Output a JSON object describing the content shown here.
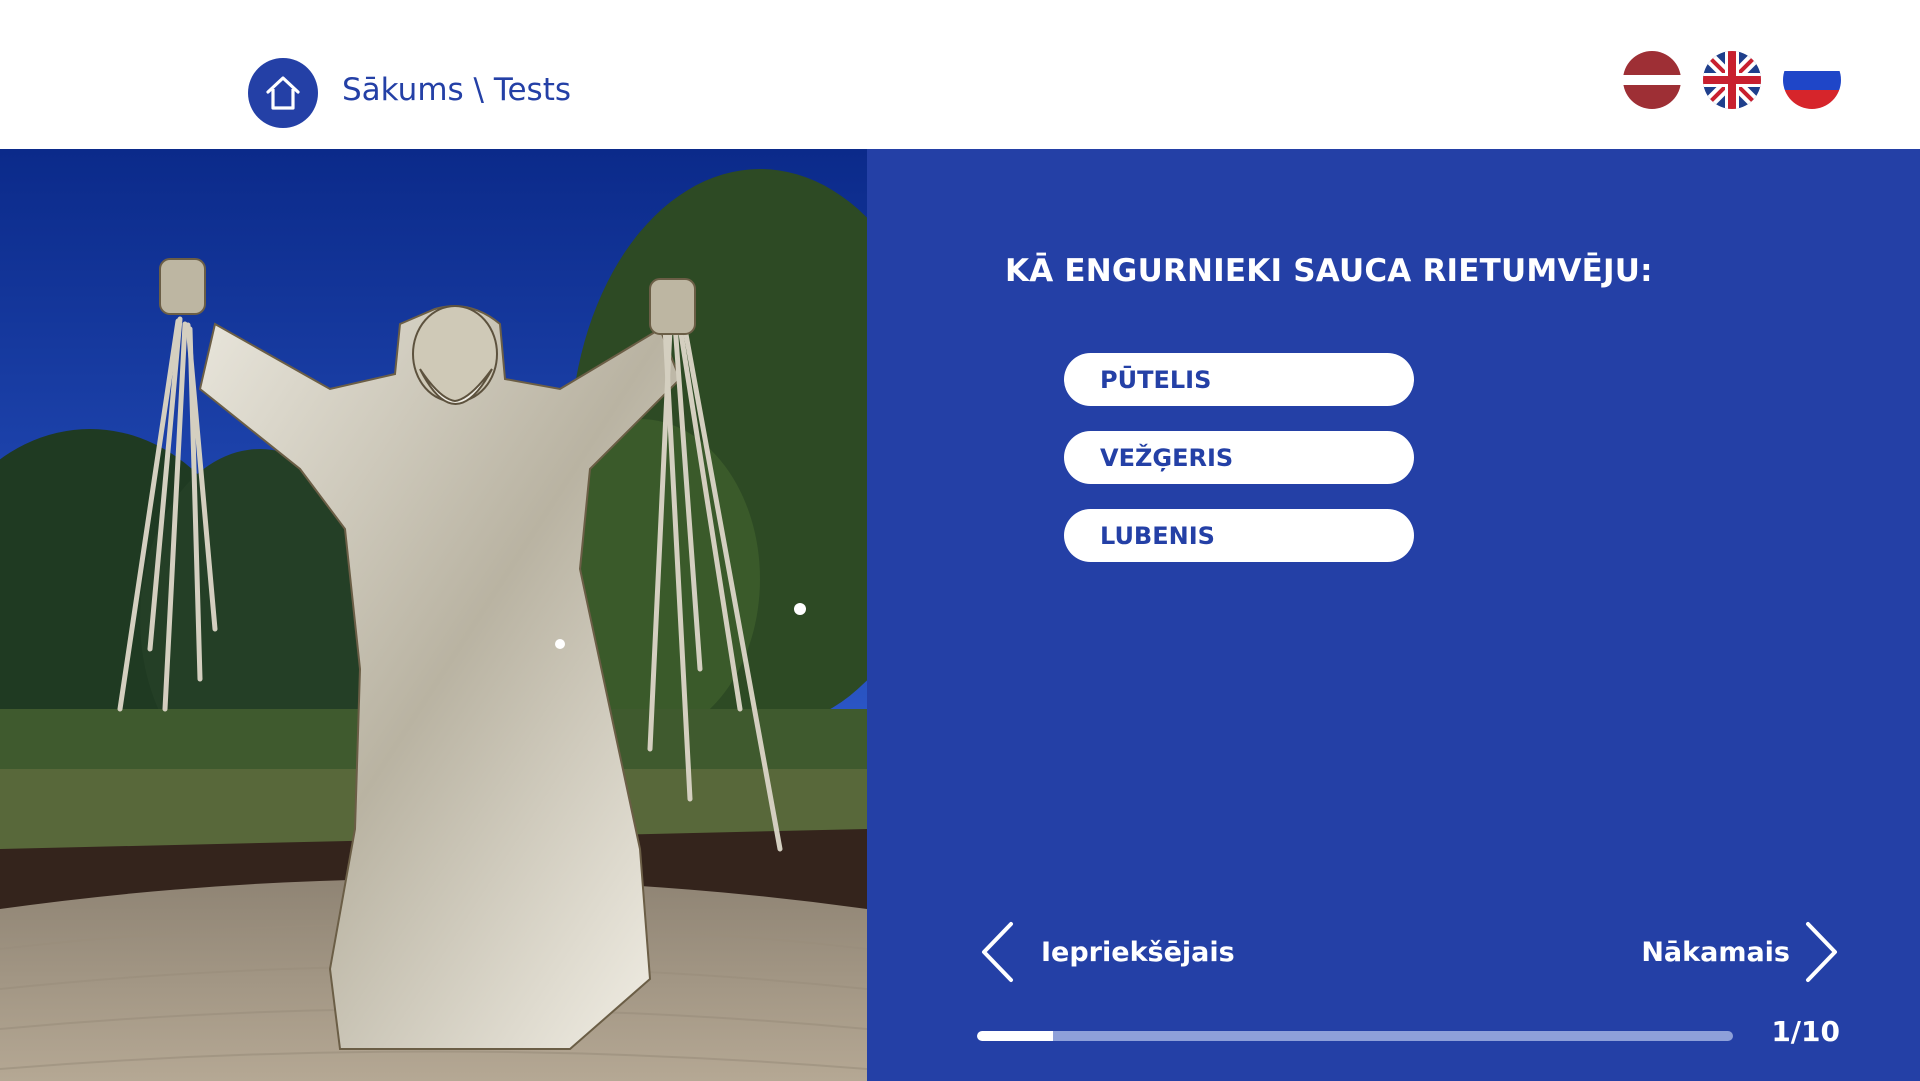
{
  "header": {
    "breadcrumb": "Sākums \\ Tests",
    "home_icon": "home-icon",
    "languages": [
      {
        "code": "lv",
        "icon": "latvia-flag-icon"
      },
      {
        "code": "en",
        "icon": "uk-flag-icon"
      },
      {
        "code": "ru",
        "icon": "russia-flag-icon"
      }
    ]
  },
  "photo": {
    "subject": "statue-photo"
  },
  "quiz": {
    "question": "KĀ ENGURNIEKI SAUCA RIETUMVĒJU:",
    "answers": [
      "PŪTELIS",
      "VEŽĢERIS",
      "LUBENIS"
    ],
    "prev_label": "Iepriekšējais",
    "next_label": "Nākamais",
    "progress_text": "1/10",
    "progress_current": 1,
    "progress_total": 10
  },
  "colors": {
    "accent": "#2440a6",
    "track": "#8ea0d9",
    "white": "#ffffff"
  }
}
